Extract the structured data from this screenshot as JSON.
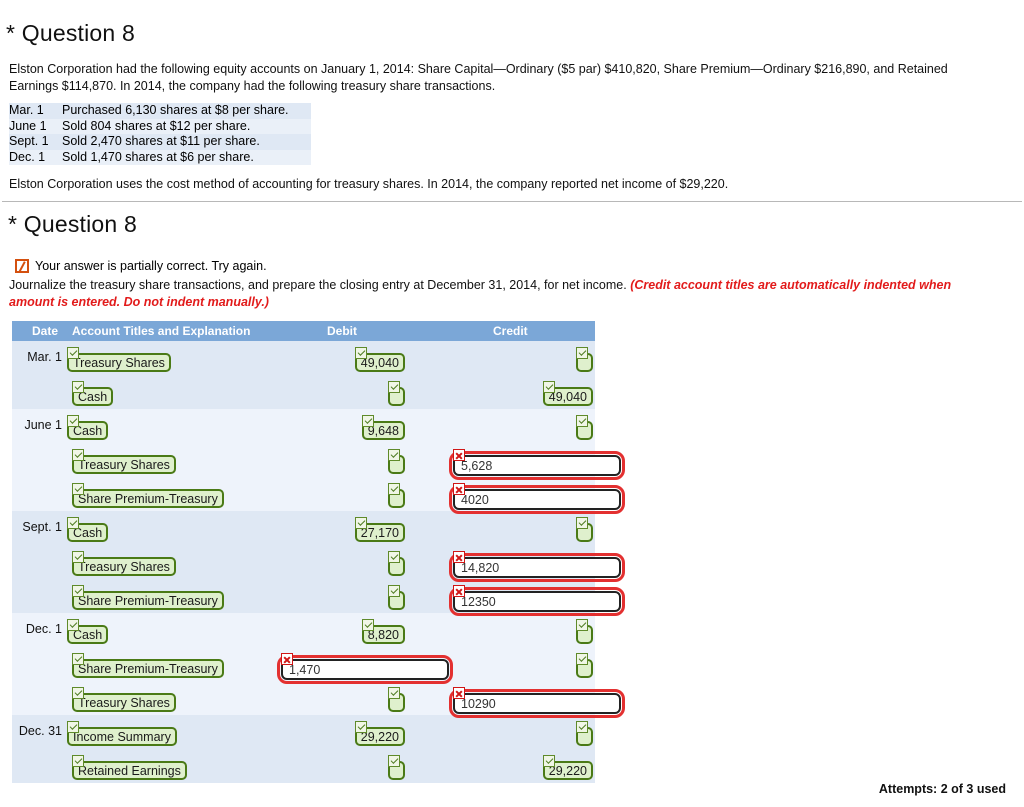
{
  "question_one": {
    "title": "* Question 8",
    "intro": "Elston Corporation had the following equity accounts on January 1, 2014: Share Capital—Ordinary ($5 par) $410,820, Share Premium—Ordinary $216,890, and Retained Earnings $114,870. In 2014, the company had the following treasury share transactions.",
    "transactions": [
      {
        "date": "Mar. 1",
        "description": "Purchased 6,130 shares at $8 per share."
      },
      {
        "date": "June 1",
        "description": "Sold 804 shares at $12 per share."
      },
      {
        "date": "Sept. 1",
        "description": "Sold 2,470 shares at $11 per share."
      },
      {
        "date": "Dec. 1",
        "description": "Sold 1,470 shares at $6 per share."
      }
    ],
    "cost_method_note": "Elston Corporation uses the cost method of accounting for treasury shares. In 2014, the company reported net income of $29,220."
  },
  "question_two": {
    "title": "* Question 8",
    "feedback": "Your answer is partially correct.  Try again.",
    "feedback_icon": "partially-correct-icon",
    "instruction_plain": "Journalize the treasury share transactions, and prepare the closing entry at December 31, 2014, for net income. ",
    "instruction_emphasis": "(Credit account titles are automatically indented when amount is entered. Do not indent manually.)"
  },
  "journal": {
    "headers": {
      "date": "Date",
      "account": "Account Titles and Explanation",
      "debit": "Debit",
      "credit": "Credit"
    },
    "groups": [
      {
        "shade": "dark",
        "rows": [
          {
            "date": "Mar. 1",
            "account": "Treasury Shares",
            "account_state": "correct",
            "indent": false,
            "debit": "49,040",
            "debit_state": "correct",
            "credit": "",
            "credit_state": "correct"
          },
          {
            "date": "",
            "account": "Cash",
            "account_state": "correct",
            "indent": true,
            "debit": "",
            "debit_state": "correct",
            "credit": "49,040",
            "credit_state": "correct"
          }
        ]
      },
      {
        "shade": "light",
        "rows": [
          {
            "date": "June 1",
            "account": "Cash",
            "account_state": "correct",
            "indent": false,
            "debit": "9,648",
            "debit_state": "correct",
            "credit": "",
            "credit_state": "correct"
          },
          {
            "date": "",
            "account": "Treasury Shares",
            "account_state": "correct",
            "indent": true,
            "debit": "",
            "debit_state": "correct",
            "credit": "5,628",
            "credit_state": "incorrect"
          },
          {
            "date": "",
            "account": "Share Premium-Treasury",
            "account_state": "correct",
            "indent": true,
            "debit": "",
            "debit_state": "correct",
            "credit": "4020",
            "credit_state": "incorrect"
          }
        ]
      },
      {
        "shade": "dark",
        "rows": [
          {
            "date": "Sept. 1",
            "account": "Cash",
            "account_state": "correct",
            "indent": false,
            "debit": "27,170",
            "debit_state": "correct",
            "credit": "",
            "credit_state": "correct"
          },
          {
            "date": "",
            "account": "Treasury Shares",
            "account_state": "correct",
            "indent": true,
            "debit": "",
            "debit_state": "correct",
            "credit": "14,820",
            "credit_state": "incorrect"
          },
          {
            "date": "",
            "account": "Share Premium-Treasury",
            "account_state": "correct",
            "indent": true,
            "debit": "",
            "debit_state": "correct",
            "credit": "12350",
            "credit_state": "incorrect"
          }
        ]
      },
      {
        "shade": "light",
        "rows": [
          {
            "date": "Dec. 1",
            "account": "Cash",
            "account_state": "correct",
            "indent": false,
            "debit": "8,820",
            "debit_state": "correct",
            "credit": "",
            "credit_state": "correct"
          },
          {
            "date": "",
            "account": "Share Premium-Treasury",
            "account_state": "correct",
            "indent": true,
            "debit": "1,470",
            "debit_state": "incorrect",
            "credit": "",
            "credit_state": "correct"
          },
          {
            "date": "",
            "account": "Treasury Shares",
            "account_state": "correct",
            "indent": true,
            "debit": "",
            "debit_state": "correct",
            "credit": "10290",
            "credit_state": "incorrect"
          }
        ]
      },
      {
        "shade": "dark",
        "rows": [
          {
            "date": "Dec. 31",
            "account": "Income Summary",
            "account_state": "correct",
            "indent": false,
            "debit": "29,220",
            "debit_state": "correct",
            "credit": "",
            "credit_state": "correct"
          },
          {
            "date": "",
            "account": "Retained Earnings",
            "account_state": "correct",
            "indent": true,
            "debit": "",
            "debit_state": "correct",
            "credit": "29,220",
            "credit_state": "correct"
          }
        ]
      }
    ]
  },
  "footer": {
    "attempts": "Attempts: 2 of 3 used"
  },
  "colors": {
    "table_header_bg": "#7ba7d7",
    "row_dark": "#dfe8f4",
    "row_light": "#eef3fb",
    "correct_border": "#4a7a16",
    "correct_fill": "#dff0cd",
    "error_outline": "#e33030",
    "error_badge": "#d01616",
    "emphasis_red": "#e21b1b",
    "partial_icon": "#d4500f"
  }
}
